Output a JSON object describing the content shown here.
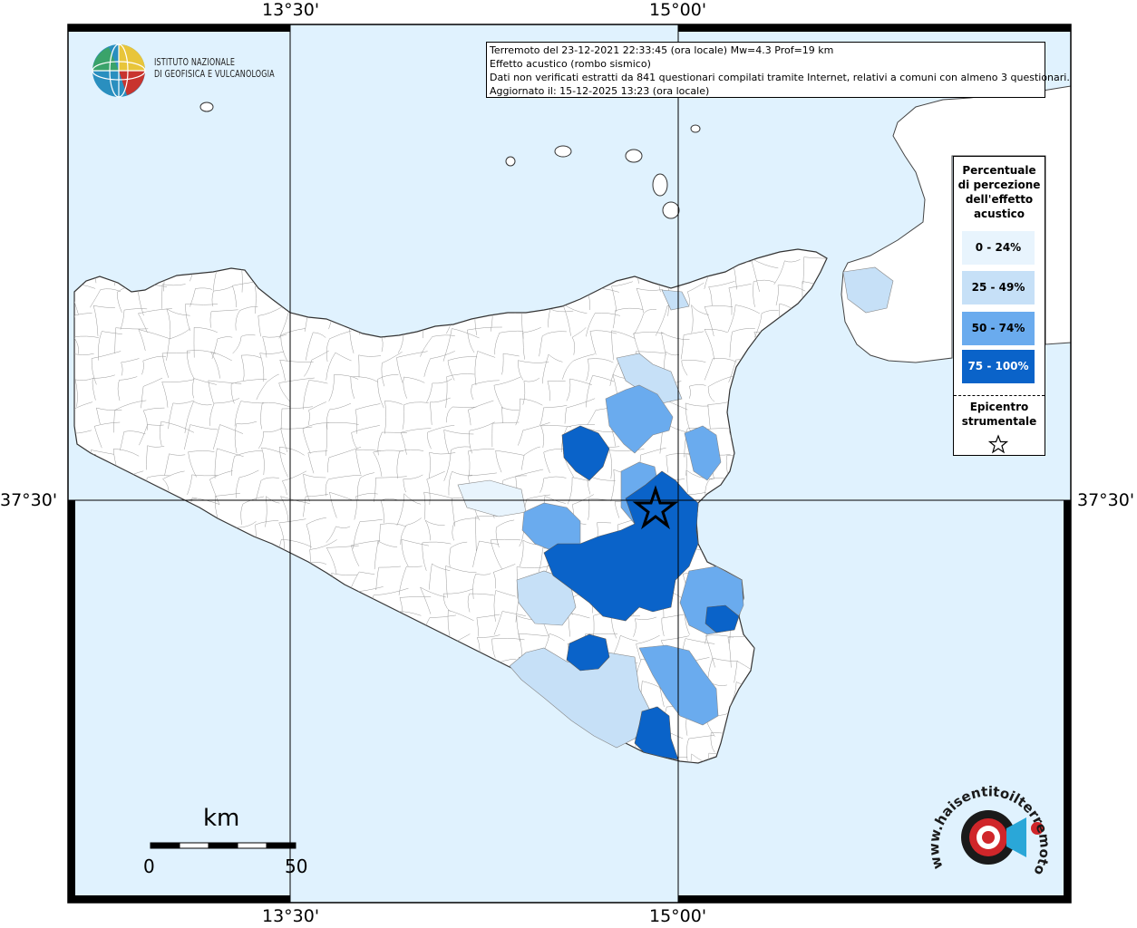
{
  "map": {
    "lon_labels": [
      "13°30'",
      "15°00'"
    ],
    "lat_labels": [
      "37°30'"
    ],
    "info_lines": [
      "Terremoto del 23-12-2021 22:33:45 (ora locale) Mw=4.3 Prof=19 km",
      "Effetto acustico (rombo sismico)",
      "Dati non verificati estratti da 841 questionari compilati tramite Internet, relativi a comuni con almeno 3 questionari.",
      "Aggiornato il: 15-12-2025 13:23 (ora locale)"
    ],
    "sea_color": "#e0f2fe",
    "land_color": "#ffffff"
  },
  "logo": {
    "line1": "ISTITUTO NAZIONALE",
    "line2": "DI GEOFISICA E VULCANOLOGIA",
    "site_text": "www.haisentitoilterremoto.it"
  },
  "legend": {
    "title": [
      "Percentuale",
      "di percezione",
      "dell'effetto",
      "acustico"
    ],
    "classes": [
      {
        "label": "0 - 24%",
        "color": "#e8f4fd"
      },
      {
        "label": "25 - 49%",
        "color": "#c6e0f7"
      },
      {
        "label": "50 - 74%",
        "color": "#6aabee"
      },
      {
        "label": "75 - 100%",
        "color": "#0a63c9"
      }
    ],
    "epicenter_title": [
      "Epicentro",
      "strumentale"
    ]
  },
  "scale": {
    "unit": "km",
    "min": "0",
    "max": "50"
  }
}
